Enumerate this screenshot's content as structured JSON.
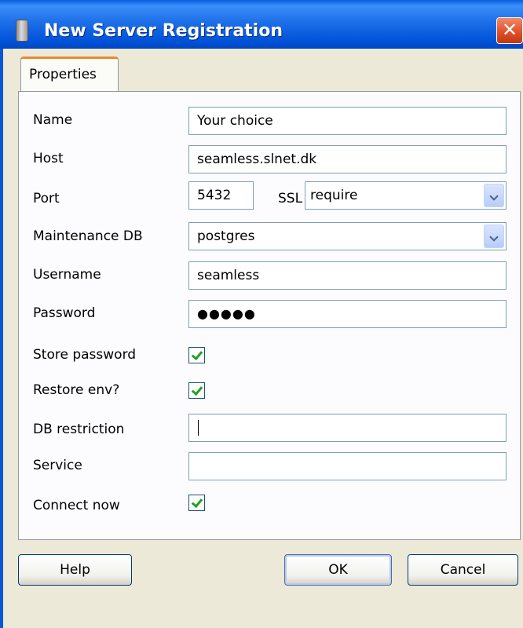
{
  "window": {
    "title": "New Server Registration",
    "close_glyph": "✕"
  },
  "tabs": [
    {
      "label": "Properties"
    }
  ],
  "form": {
    "name": {
      "label": "Name",
      "value": "Your choice"
    },
    "host": {
      "label": "Host",
      "value": "seamless.slnet.dk"
    },
    "port": {
      "label": "Port",
      "value": "5432"
    },
    "ssl": {
      "label": "SSL",
      "value": "require"
    },
    "maintenance_db": {
      "label": "Maintenance DB",
      "value": "postgres"
    },
    "username": {
      "label": "Username",
      "value": "seamless"
    },
    "password": {
      "label": "Password",
      "value": "●●●●●"
    },
    "store_password": {
      "label": "Store password",
      "checked": true
    },
    "restore_env": {
      "label": "Restore env?",
      "checked": true
    },
    "db_restriction": {
      "label": "DB restriction",
      "value": ""
    },
    "service": {
      "label": "Service",
      "value": ""
    },
    "connect_now": {
      "label": "Connect now",
      "checked": true
    }
  },
  "buttons": {
    "help": "Help",
    "ok": "OK",
    "cancel": "Cancel"
  },
  "icons": {
    "title": "server-icon",
    "close": "close-icon",
    "dropdown": "chevron-down-icon",
    "check": "checkmark-icon"
  }
}
